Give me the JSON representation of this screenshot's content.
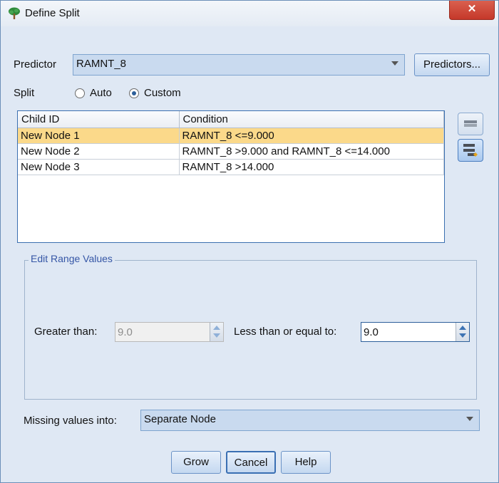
{
  "window": {
    "title": "Define Split",
    "close_glyph": "✕"
  },
  "predictor": {
    "label": "Predictor",
    "value": "RAMNT_8",
    "button": "Predictors..."
  },
  "split": {
    "label": "Split",
    "options": [
      "Auto",
      "Custom"
    ],
    "selected": "Custom"
  },
  "table": {
    "columns": [
      "Child ID",
      "Condition"
    ],
    "rows": [
      {
        "child_id": "New Node 1",
        "condition": "RAMNT_8 <=9.000"
      },
      {
        "child_id": "New Node 2",
        "condition": "RAMNT_8 >9.000 and RAMNT_8 <=14.000"
      },
      {
        "child_id": "New Node 3",
        "condition": "RAMNT_8 >14.000"
      }
    ],
    "selected_row": 0
  },
  "side_buttons": [
    "merge-nodes-icon",
    "split-node-icon"
  ],
  "edit_range": {
    "title": "Edit Range Values",
    "greater_label": "Greater than:",
    "greater_value": "9.0",
    "lte_label": "Less than or equal to:",
    "lte_value": "9.0"
  },
  "missing": {
    "label": "Missing values into:",
    "value": "Separate Node"
  },
  "buttons": {
    "grow": "Grow",
    "cancel": "Cancel",
    "help": "Help"
  }
}
